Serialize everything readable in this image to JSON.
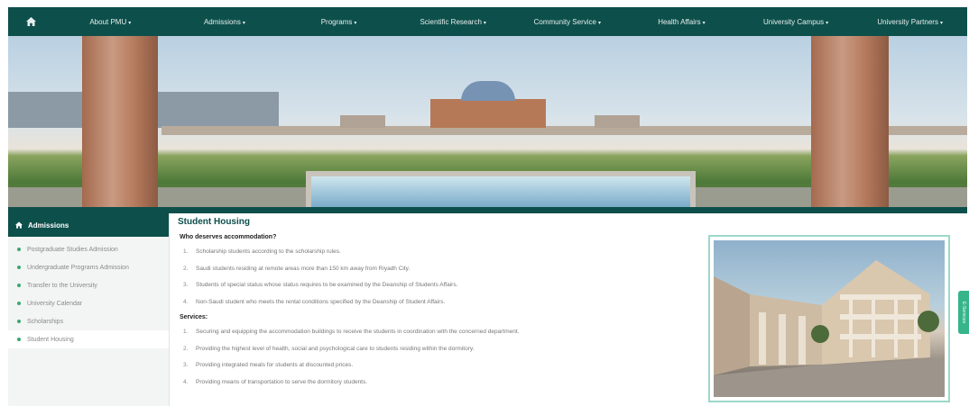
{
  "nav": {
    "items": [
      {
        "label": "About PMU"
      },
      {
        "label": "Admissions"
      },
      {
        "label": "Programs"
      },
      {
        "label": "Scientific Research"
      },
      {
        "label": "Community Service"
      },
      {
        "label": "Health Affairs"
      },
      {
        "label": "University Campus"
      },
      {
        "label": "University Partners"
      }
    ],
    "caret": "▾"
  },
  "sidebar": {
    "title": "Admissions",
    "items": [
      {
        "label": "Postgraduate Studies Admission"
      },
      {
        "label": "Undergraduate Programs Admission"
      },
      {
        "label": "Transfer to the University"
      },
      {
        "label": "University Calendar"
      },
      {
        "label": "Scholarships"
      },
      {
        "label": "Student Housing"
      }
    ]
  },
  "main": {
    "title": "Student Housing",
    "section1": {
      "heading": "Who deserves accommodation?",
      "items": [
        {
          "n": "1.",
          "text": "Scholarship students according to the scholarship rules."
        },
        {
          "n": "2.",
          "text": "Saudi students residing at remote areas more than 150 km away from Riyadh City."
        },
        {
          "n": "3.",
          "text": "Students of special status whose status requires to be examined by the Deanship of Students Affairs."
        },
        {
          "n": "4.",
          "text": "Non-Saudi student who meets the rental conditions specified by the Deanship of Student Affairs."
        }
      ]
    },
    "section2": {
      "heading": "Services:",
      "items": [
        {
          "n": "1.",
          "text": "Securing and equipping the accommodation buildings to receive the students in coordination with the concerned department."
        },
        {
          "n": "2.",
          "text": "Providing the highest level of health, social and psychological care to students residing within the dormitory."
        },
        {
          "n": "3.",
          "text": "Providing integrated meals for students at discounted prices."
        },
        {
          "n": "4.",
          "text": "Providing means of transportation to serve the dormitory students."
        }
      ]
    }
  },
  "feedback_tab": {
    "label": "E-Services"
  },
  "colors": {
    "brand": "#0d4f4b",
    "accent": "#3aa86f",
    "frame": "#9cd8c9"
  }
}
